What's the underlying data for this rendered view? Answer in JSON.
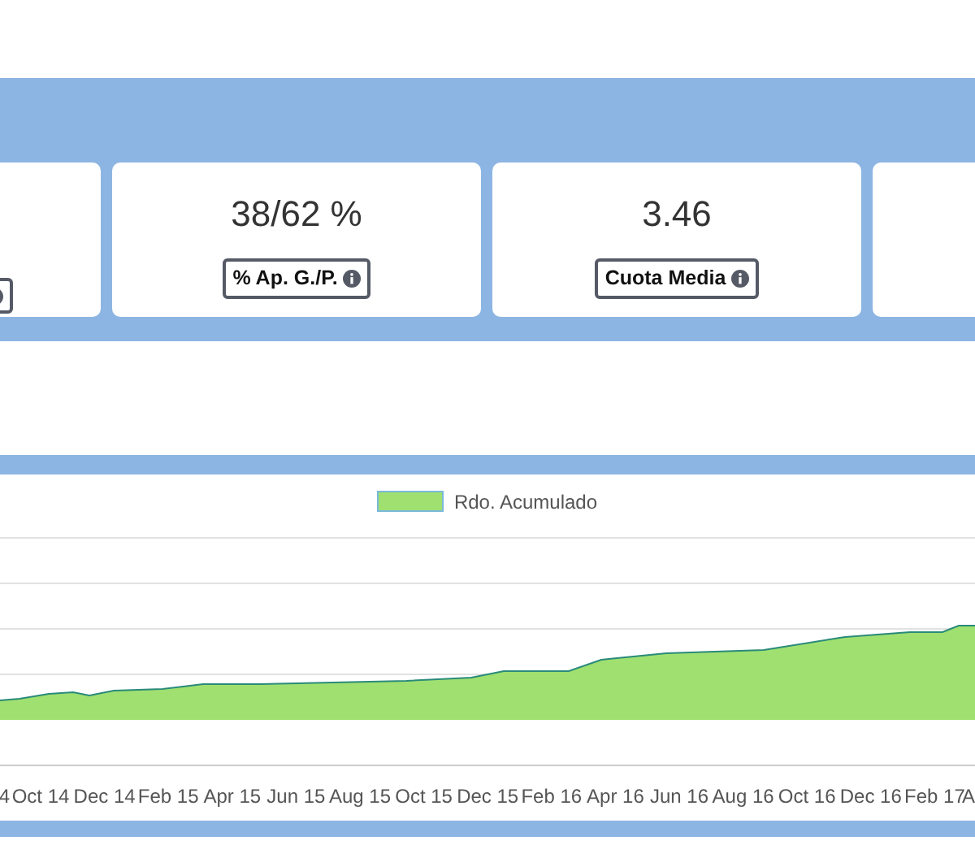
{
  "cards": [
    {
      "value": "38/62 %",
      "label": "% Ap. G./P."
    },
    {
      "value": "3.46",
      "label": "Cuota Media"
    }
  ],
  "chart": {
    "legend": "Rdo. Acumulado",
    "x_labels": [
      "4",
      "Oct 14",
      "Dec 14",
      "Feb 15",
      "Apr 15",
      "Jun 15",
      "Aug 15",
      "Oct 15",
      "Dec 15",
      "Feb 16",
      "Apr 16",
      "Jun 16",
      "Aug 16",
      "Oct 16",
      "Dec 16",
      "Feb 17",
      "A"
    ]
  }
}
